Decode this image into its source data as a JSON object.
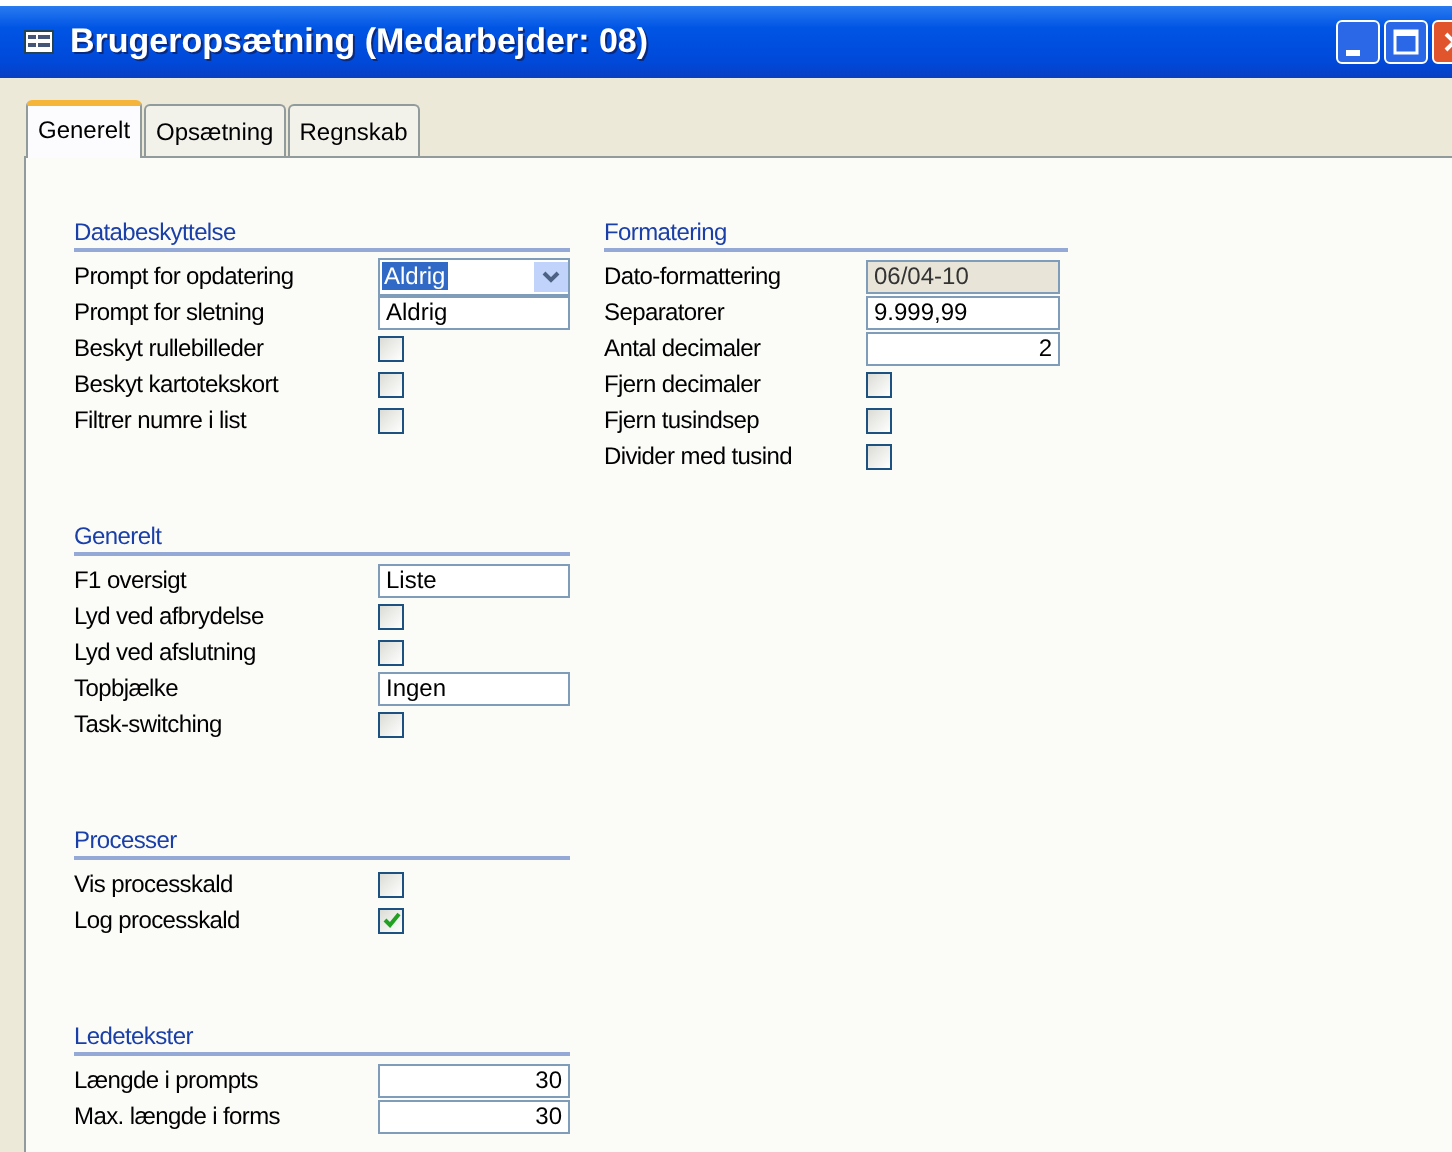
{
  "window": {
    "title": "Brugeropsætning (Medarbejder: 08)"
  },
  "tabs": [
    {
      "label": "Generelt",
      "selected": true
    },
    {
      "label": "Opsætning",
      "selected": false
    },
    {
      "label": "Regnskab",
      "selected": false
    }
  ],
  "columns": [
    {
      "sections": [
        {
          "heading": "Databeskyttelse",
          "rows": [
            {
              "label": "Prompt for opdatering",
              "kind": "dropdown",
              "value": "Aldrig",
              "selected": true
            },
            {
              "label": "Prompt for sletning",
              "kind": "text",
              "value": "Aldrig"
            },
            {
              "label": "Beskyt rullebilleder",
              "kind": "checkbox",
              "checked": false
            },
            {
              "label": "Beskyt kartotekskort",
              "kind": "checkbox",
              "checked": false
            },
            {
              "label": "Filtrer numre i list",
              "kind": "checkbox",
              "checked": false
            }
          ]
        },
        {
          "heading": "Generelt",
          "rows": [
            {
              "label": "F1 oversigt",
              "kind": "text",
              "value": "Liste"
            },
            {
              "label": "Lyd ved afbrydelse",
              "kind": "checkbox",
              "checked": false
            },
            {
              "label": "Lyd ved afslutning",
              "kind": "checkbox",
              "checked": false
            },
            {
              "label": "Topbjælke",
              "kind": "text",
              "value": "Ingen"
            },
            {
              "label": "Task-switching",
              "kind": "checkbox",
              "checked": false
            }
          ]
        },
        {
          "heading": "Processer",
          "rows": [
            {
              "label": "Vis processkald",
              "kind": "checkbox",
              "checked": false
            },
            {
              "label": "Log processkald",
              "kind": "checkbox",
              "checked": true
            }
          ]
        },
        {
          "heading": "Ledetekster",
          "rows": [
            {
              "label": "Længde i prompts",
              "kind": "number",
              "value": "30"
            },
            {
              "label": "Max. længde i forms",
              "kind": "number",
              "value": "30"
            }
          ]
        }
      ]
    },
    {
      "sections": [
        {
          "heading": "Formatering",
          "rows": [
            {
              "label": "Dato-formattering",
              "kind": "readonly",
              "value": "06/04-10"
            },
            {
              "label": "Separatorer",
              "kind": "text",
              "value": "9.999,99"
            },
            {
              "label": "Antal decimaler",
              "kind": "number",
              "value": "2"
            },
            {
              "label": "Fjern decimaler",
              "kind": "checkbox",
              "checked": false
            },
            {
              "label": "Fjern tusindsep",
              "kind": "checkbox",
              "checked": false
            },
            {
              "label": "Divider med tusind",
              "kind": "checkbox",
              "checked": false
            }
          ]
        }
      ]
    }
  ]
}
